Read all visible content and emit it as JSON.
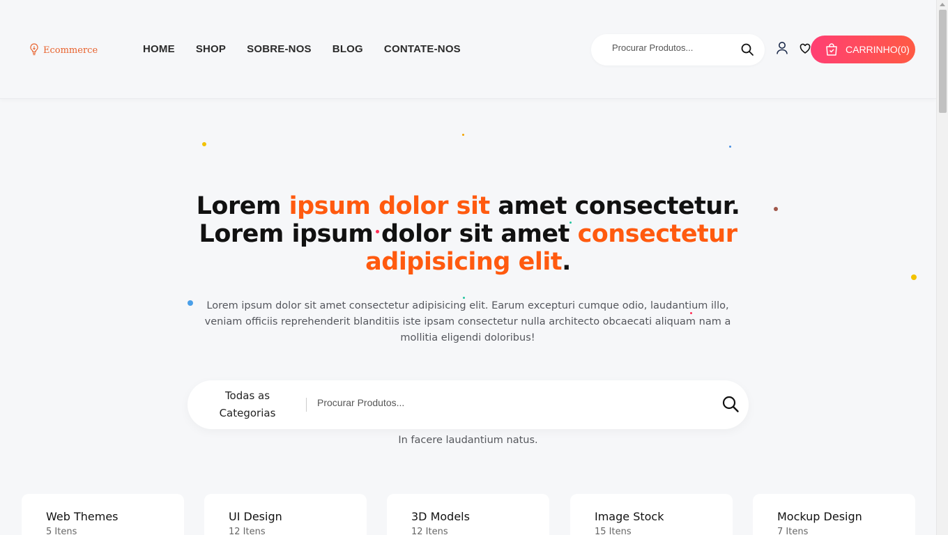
{
  "brand": {
    "name": "Ecommerce",
    "accent": "#ff5a0f",
    "logo_icon": "lightbulb-icon"
  },
  "nav": [
    "HOME",
    "SHOP",
    "SOBRE-NOS",
    "BLOG",
    "CONTATE-NOS"
  ],
  "header_search": {
    "placeholder": "Procurar Produtos...",
    "icon": "search-icon"
  },
  "header_icons": {
    "user": "user-icon",
    "wishlist": "heart-icon"
  },
  "cart": {
    "label": "CARRINHO(0)",
    "icon": "shopping-bag-icon",
    "gradient": [
      "#ff3f73",
      "#ff5a44"
    ]
  },
  "hero": {
    "line1_a": "Lorem ",
    "line1_hl": "ipsum dolor sit",
    "line1_b": " amet consectetur.",
    "line2_a": "Lorem ipsum dolor sit amet ",
    "line2_hl": "consectetur adipisicing elit",
    "line2_end": ".",
    "subtitle": "Lorem ipsum dolor sit amet consectetur adipisicing elit. Earum excepturi cumque odio, laudantium illo, veniam officiis reprehenderit blanditiis iste ipsam consectetur nulla architecto obcaecati aliquam nam a mollitia eligendi doloribus!"
  },
  "main_search": {
    "category_label": "Todas as Categorias",
    "placeholder": "Procurar Produtos...",
    "hint": "In facere laudantium natus."
  },
  "categories": [
    {
      "title": "Web Themes",
      "count": "5 Itens"
    },
    {
      "title": "UI Design",
      "count": "12 Itens"
    },
    {
      "title": "3D Models",
      "count": "12 Itens"
    },
    {
      "title": "Image Stock",
      "count": "15 Itens"
    },
    {
      "title": "Mockup Design",
      "count": "7 Itens"
    }
  ]
}
